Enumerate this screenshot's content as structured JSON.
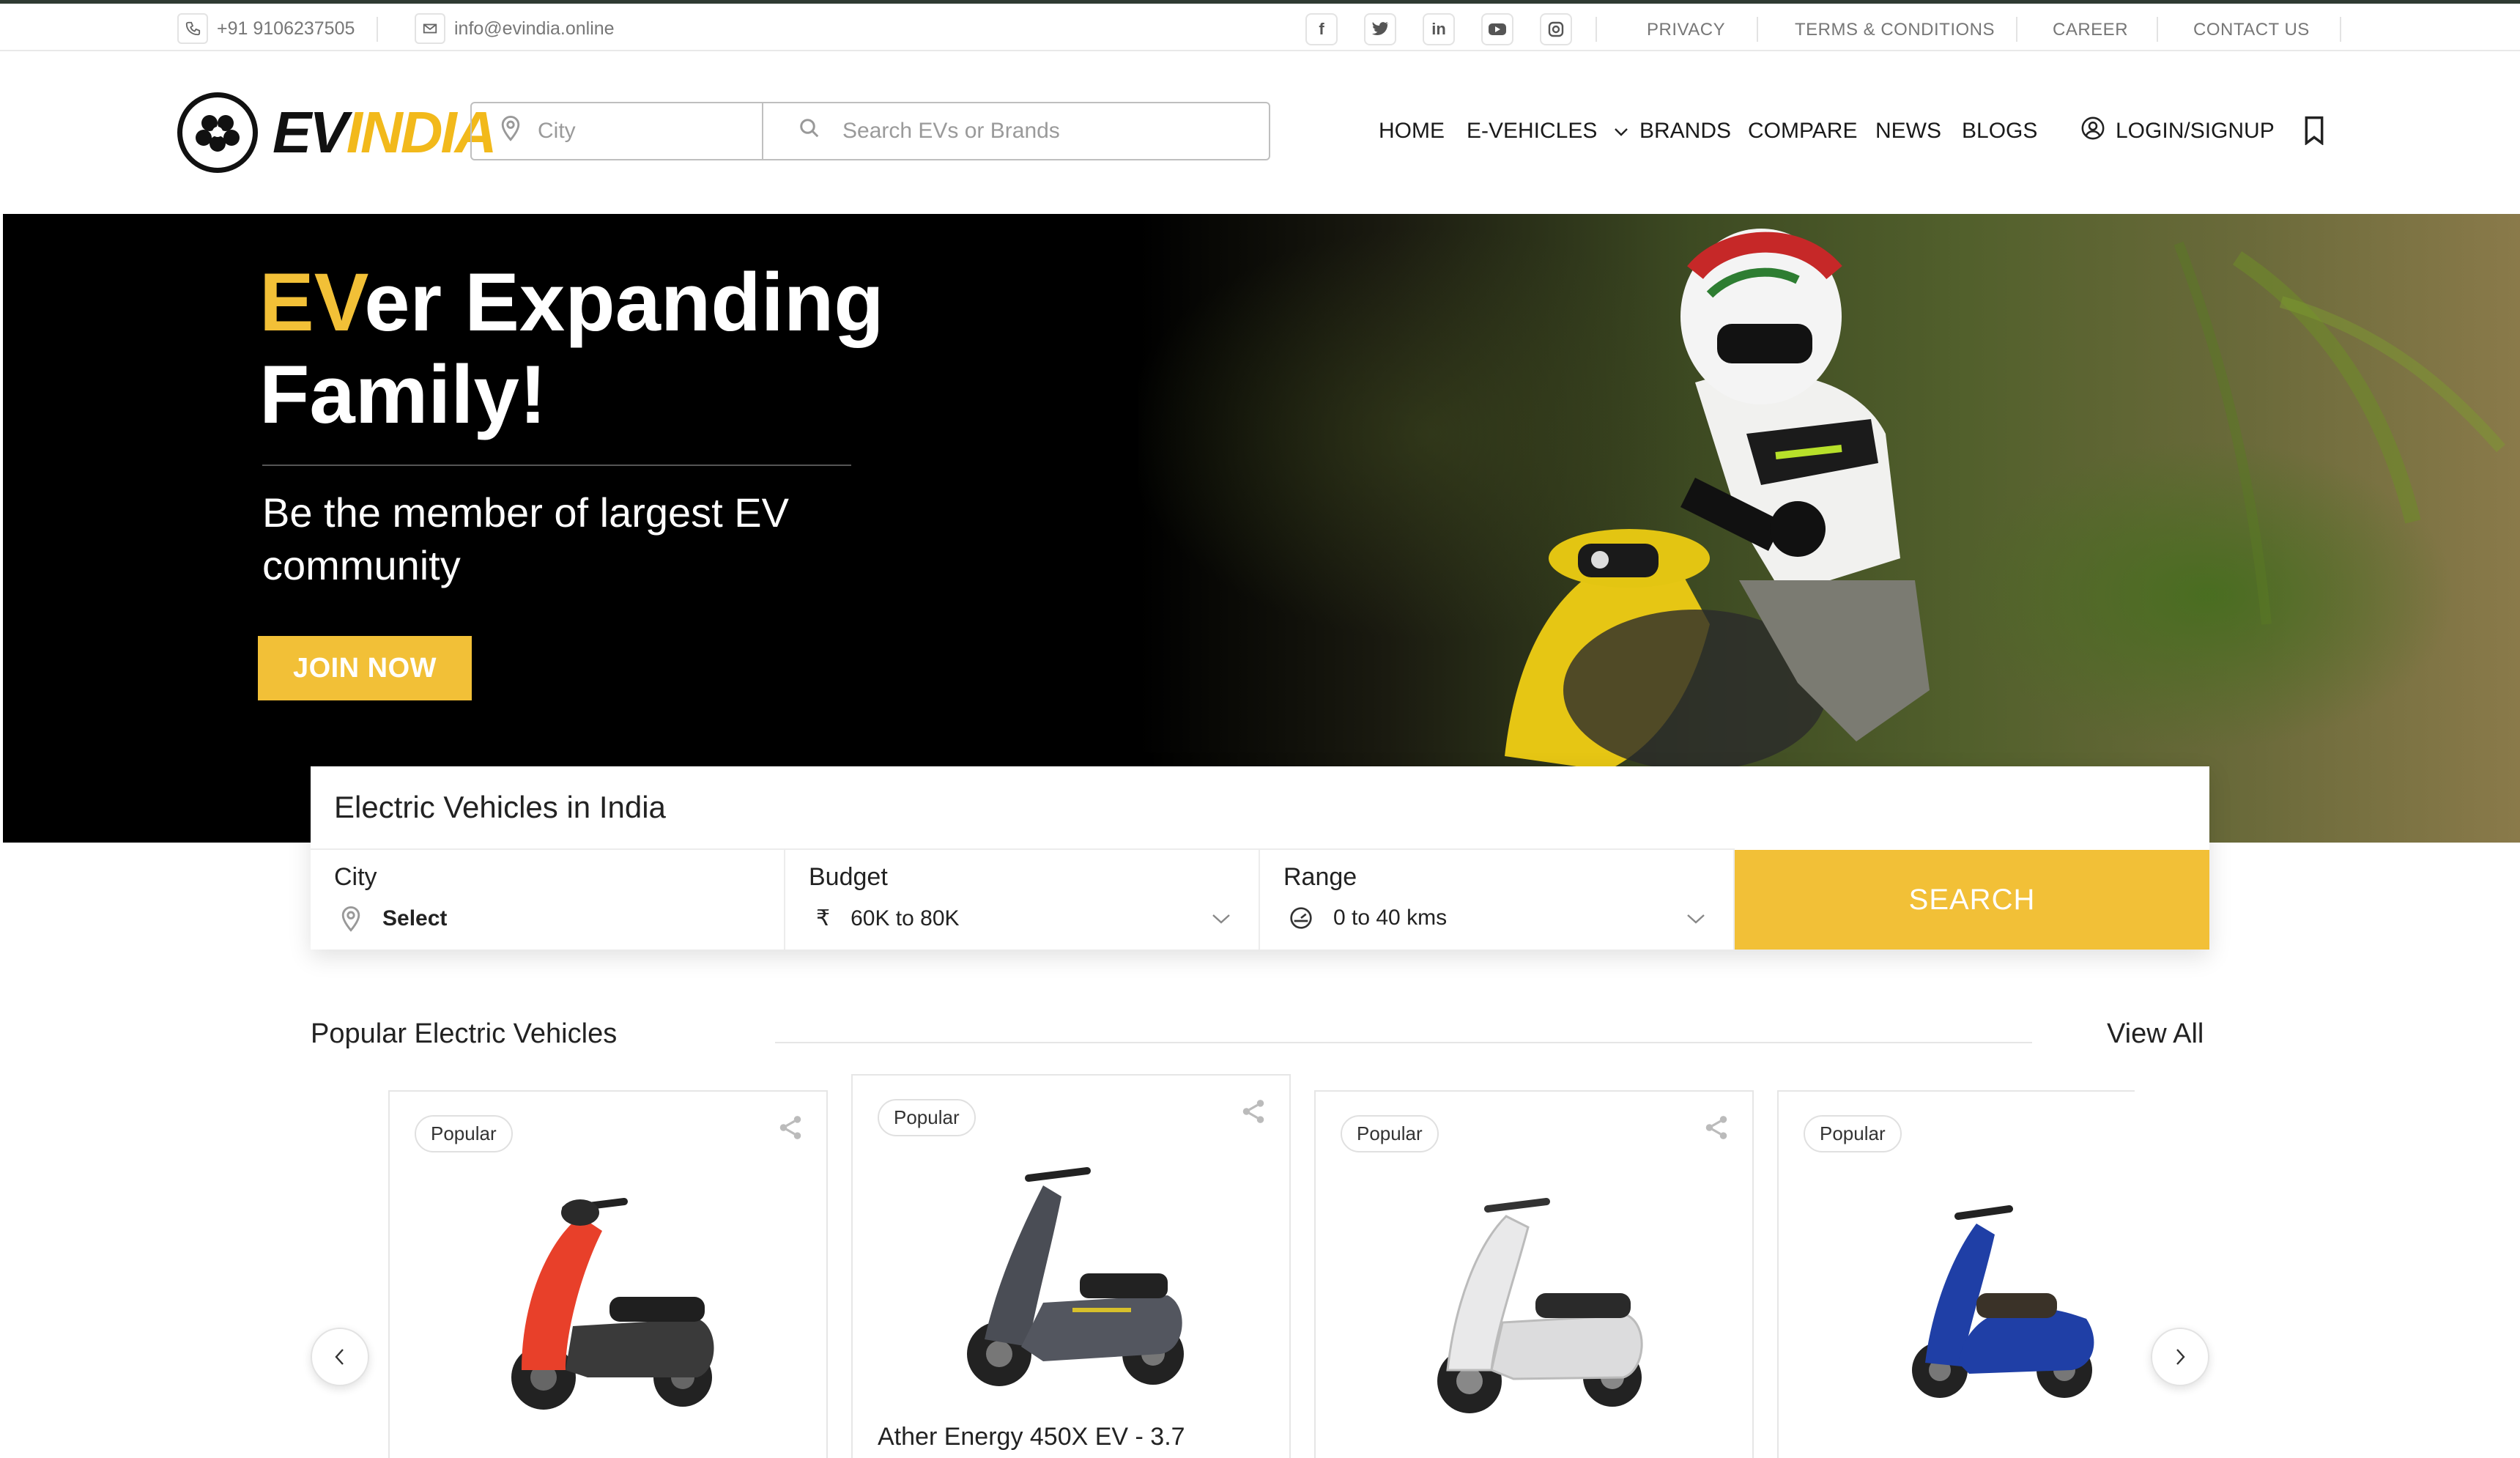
{
  "topbar": {
    "phone": "+91 9106237505",
    "email": "info@evindia.online",
    "social_icons": [
      "facebook-icon",
      "twitter-icon",
      "linkedin-icon",
      "youtube-icon",
      "instagram-icon"
    ],
    "links": [
      "PRIVACY",
      "TERMS & CONDITIONS",
      "CAREER",
      "CONTACT US"
    ]
  },
  "header": {
    "logo_ev": "EV",
    "logo_india": "INDIA",
    "city_placeholder": "City",
    "search_placeholder": "Search EVs or Brands",
    "nav": [
      "HOME",
      "E-VEHICLES",
      "BRANDS",
      "COMPARE",
      "NEWS",
      "BLOGS"
    ],
    "login_label": "LOGIN/SIGNUP"
  },
  "hero": {
    "title_highlight": "EV",
    "title_rest_line1": "er Expanding",
    "title_line2": "Family!",
    "subtitle": "Be the member of largest EV community",
    "join_label": "JOIN NOW"
  },
  "search_card": {
    "title": "Electric Vehicles in India",
    "city_label": "City",
    "city_value": "Select",
    "budget_label": "Budget",
    "budget_value": "60K to 80K",
    "range_label": "Range",
    "range_value": "0 to 40 kms",
    "search_label": "SEARCH"
  },
  "popular": {
    "title": "Popular Electric Vehicles",
    "view_all": "View All",
    "cards": [
      {
        "badge": "Popular",
        "name": "",
        "color": "#e8402a"
      },
      {
        "badge": "Popular",
        "name": "Ather Energy 450X EV - 3.7",
        "color": "#4a4d55"
      },
      {
        "badge": "Popular",
        "name": "",
        "color": "#e9e9ea"
      },
      {
        "badge": "Popular",
        "name": "",
        "color": "#1f3fa6"
      }
    ]
  },
  "colors": {
    "accent": "#f2c037",
    "dark": "#000000"
  }
}
